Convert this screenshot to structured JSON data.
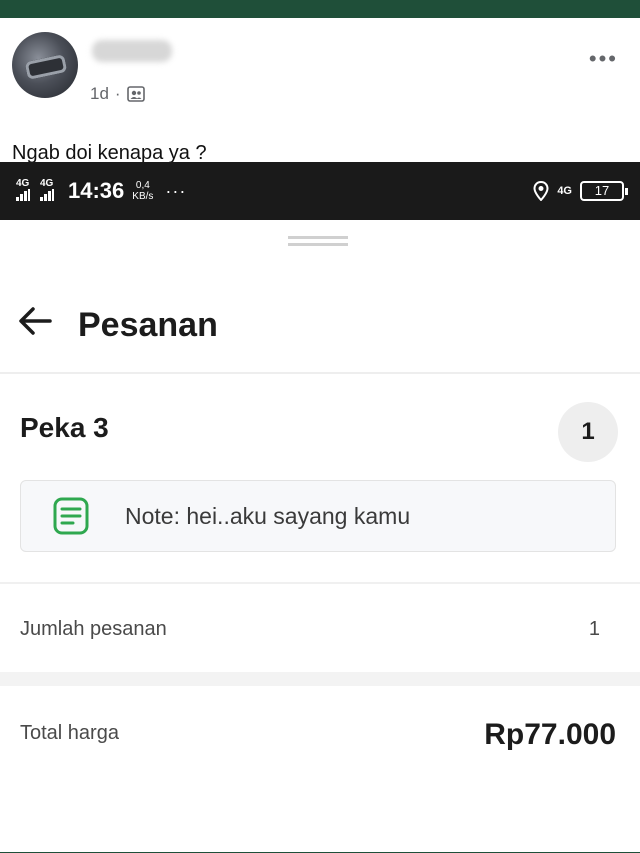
{
  "post": {
    "meta_time": "1d",
    "meta_separator": "·",
    "caption": "Ngab doi kenapa ya ?"
  },
  "statusbar": {
    "signal1": "4G",
    "signal2": "4G",
    "time": "14:36",
    "speed_value": "0,4",
    "speed_unit": "KB/s",
    "overflow": "···",
    "network": "4G",
    "battery": "17"
  },
  "app": {
    "title": "Pesanan",
    "item_name": "Peka 3",
    "item_qty": "1",
    "note": "Note: hei..aku sayang kamu",
    "order_count_label": "Jumlah pesanan",
    "order_count_value": "1",
    "total_label": "Total harga",
    "total_value": "Rp77.000"
  },
  "icons": {
    "back": "arrow-left-icon",
    "note": "note-icon",
    "more": "more-horizontal-icon",
    "audience": "friends-icon",
    "location": "location-icon"
  },
  "colors": {
    "frame_green": "#1f4f39",
    "note_icon_green": "#2fa84f",
    "status_bar": "#1a1a1a"
  }
}
